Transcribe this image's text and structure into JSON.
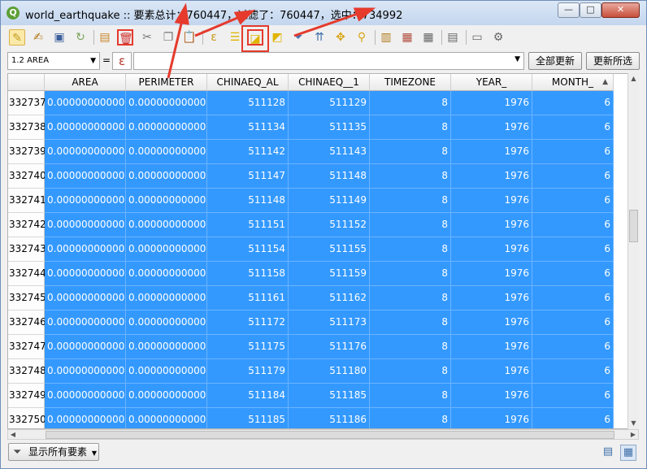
{
  "window": {
    "title": "world_earthquake :: 要素总计：760447，过滤了：760447，选中：734992",
    "app_icon_letter": "Q",
    "controls": [
      "—",
      "□",
      "✕"
    ]
  },
  "expression_bar": {
    "field": "1.2 AREA",
    "equals": "=",
    "epsilon_symbol": "ε",
    "value": "",
    "update_all_label": "全部更新",
    "update_selected_label": "更新所选"
  },
  "table": {
    "columns": [
      "AREA",
      "PERIMETER",
      "CHINAEQ_AL",
      "CHINAEQ__1",
      "TIMEZONE",
      "YEAR_",
      "MONTH_"
    ],
    "sort_indicator": "▲",
    "rows": [
      {
        "id": "332737",
        "cells": [
          "0.00000000000",
          "0.00000000000",
          "511128",
          "511129",
          "8",
          "1976",
          "6"
        ]
      },
      {
        "id": "332738",
        "cells": [
          "0.00000000000",
          "0.00000000000",
          "511134",
          "511135",
          "8",
          "1976",
          "6"
        ]
      },
      {
        "id": "332739",
        "cells": [
          "0.00000000000",
          "0.00000000000",
          "511142",
          "511143",
          "8",
          "1976",
          "6"
        ]
      },
      {
        "id": "332740",
        "cells": [
          "0.00000000000",
          "0.00000000000",
          "511147",
          "511148",
          "8",
          "1976",
          "6"
        ]
      },
      {
        "id": "332741",
        "cells": [
          "0.00000000000",
          "0.00000000000",
          "511148",
          "511149",
          "8",
          "1976",
          "6"
        ]
      },
      {
        "id": "332742",
        "cells": [
          "0.00000000000",
          "0.00000000000",
          "511151",
          "511152",
          "8",
          "1976",
          "6"
        ]
      },
      {
        "id": "332743",
        "cells": [
          "0.00000000000",
          "0.00000000000",
          "511154",
          "511155",
          "8",
          "1976",
          "6"
        ]
      },
      {
        "id": "332744",
        "cells": [
          "0.00000000000",
          "0.00000000000",
          "511158",
          "511159",
          "8",
          "1976",
          "6"
        ]
      },
      {
        "id": "332745",
        "cells": [
          "0.00000000000",
          "0.00000000000",
          "511161",
          "511162",
          "8",
          "1976",
          "6"
        ]
      },
      {
        "id": "332746",
        "cells": [
          "0.00000000000",
          "0.00000000000",
          "511172",
          "511173",
          "8",
          "1976",
          "6"
        ]
      },
      {
        "id": "332747",
        "cells": [
          "0.00000000000",
          "0.00000000000",
          "511175",
          "511176",
          "8",
          "1976",
          "6"
        ]
      },
      {
        "id": "332748",
        "cells": [
          "0.00000000000",
          "0.00000000000",
          "511179",
          "511180",
          "8",
          "1976",
          "6"
        ]
      },
      {
        "id": "332749",
        "cells": [
          "0.00000000000",
          "0.00000000000",
          "511184",
          "511185",
          "8",
          "1976",
          "6"
        ]
      },
      {
        "id": "332750",
        "cells": [
          "0.00000000000",
          "0.00000000000",
          "511185",
          "511186",
          "8",
          "1976",
          "6"
        ]
      }
    ]
  },
  "bottom": {
    "filter_label": "显示所有要素"
  },
  "colors": {
    "selection": "#3399ff",
    "annotation": "#e53a2c",
    "title_bar": "#c3d6ee"
  }
}
